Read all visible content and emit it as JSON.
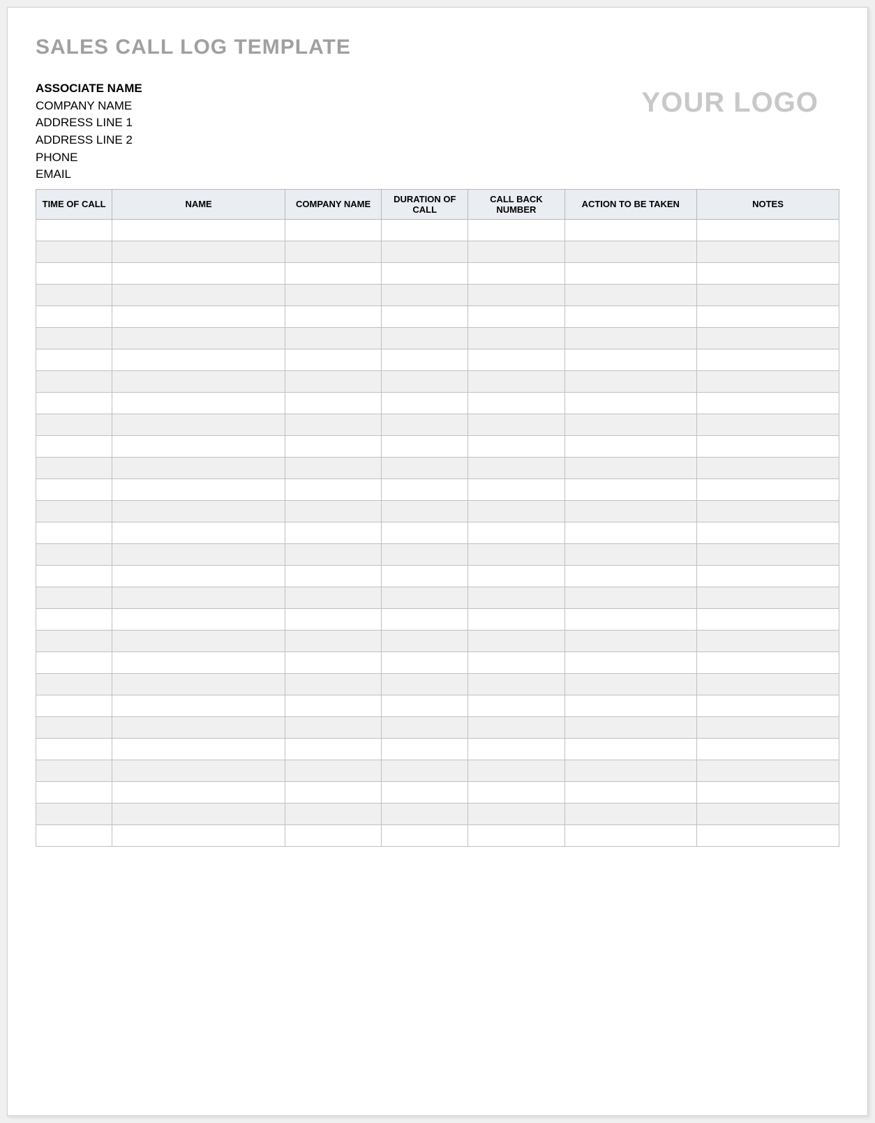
{
  "title": "SALES CALL LOG TEMPLATE",
  "associate": {
    "name_label": "ASSOCIATE NAME",
    "company": "COMPANY NAME",
    "address1": "ADDRESS LINE 1",
    "address2": "ADDRESS LINE 2",
    "phone": "PHONE",
    "email": "EMAIL"
  },
  "logo_text": "YOUR LOGO",
  "table": {
    "headers": {
      "time": "TIME OF CALL",
      "name": "NAME",
      "company": "COMPANY NAME",
      "duration": "DURATION OF CALL",
      "callback": "CALL BACK NUMBER",
      "action": "ACTION TO BE TAKEN",
      "notes": "NOTES"
    },
    "row_count": 29
  }
}
